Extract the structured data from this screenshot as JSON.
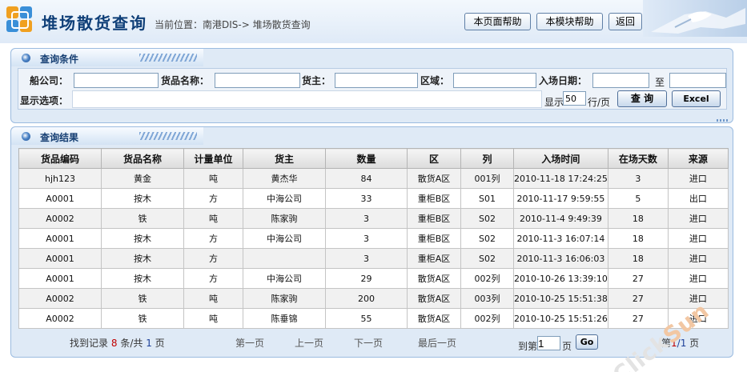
{
  "header": {
    "title": "堆场散货查询",
    "breadcrumb": "当前位置：南港DIS-> 堆场散货查询",
    "buttons": {
      "page_help": "本页面帮助",
      "module_help": "本模块帮助",
      "back": "返回"
    }
  },
  "search_panel": {
    "title": "查询条件",
    "fields": {
      "shipping_company": {
        "label": "船公司：",
        "value": ""
      },
      "goods_name": {
        "label": "货品名称：",
        "value": ""
      },
      "cargo_owner": {
        "label": "货主：",
        "value": ""
      },
      "area": {
        "label": "区域：",
        "value": ""
      },
      "entry_date": {
        "label": "入场日期：",
        "from": "",
        "to": "",
        "separator": "至"
      },
      "display_options": {
        "label": "显示选项："
      }
    },
    "page_size": {
      "prefix": "显示",
      "value": "50",
      "suffix": "行/页"
    },
    "query_button": "查 询",
    "excel_button": "Excel"
  },
  "results_panel": {
    "title": "查询结果",
    "columns": [
      "货品编码",
      "货品名称",
      "计量单位",
      "货主",
      "数量",
      "区",
      "列",
      "入场时间",
      "在场天数",
      "来源"
    ],
    "rows": [
      [
        "hjh123",
        "黄金",
        "吨",
        "黄杰华",
        "84",
        "散货A区",
        "001列",
        "2010-11-18 17:24:25",
        "3",
        "进口"
      ],
      [
        "A0001",
        "按木",
        "方",
        "中海公司",
        "33",
        "重柜B区",
        "S01",
        "2010-11-17 9:59:55",
        "5",
        "出口"
      ],
      [
        "A0002",
        "铁",
        "吨",
        "陈家驹",
        "3",
        "重柜B区",
        "S02",
        "2010-11-4 9:49:39",
        "18",
        "进口"
      ],
      [
        "A0001",
        "按木",
        "方",
        "中海公司",
        "3",
        "重柜B区",
        "S02",
        "2010-11-3 16:07:14",
        "18",
        "进口"
      ],
      [
        "A0001",
        "按木",
        "方",
        "",
        "3",
        "重柜A区",
        "S02",
        "2010-11-3 16:06:03",
        "18",
        "进口"
      ],
      [
        "A0001",
        "按木",
        "方",
        "中海公司",
        "29",
        "散货A区",
        "002列",
        "2010-10-26 13:39:10",
        "27",
        "进口"
      ],
      [
        "A0002",
        "铁",
        "吨",
        "陈家驹",
        "200",
        "散货A区",
        "003列",
        "2010-10-25 15:51:38",
        "27",
        "进口"
      ],
      [
        "A0002",
        "铁",
        "吨",
        "陈垂锦",
        "55",
        "散货A区",
        "002列",
        "2010-10-25 15:51:26",
        "27",
        "进口"
      ]
    ],
    "pager": {
      "found_prefix": "找到记录",
      "found_count": "8",
      "found_mid": "条/共",
      "total_pages": "1",
      "found_suffix": "页",
      "first": "第一页",
      "prev": "上一页",
      "next": "下一页",
      "last": "最后一页",
      "goto_prefix": "到第",
      "goto_value": "1",
      "goto_suffix": "页",
      "go_button": "Go",
      "current_prefix": "第",
      "current_page": "1",
      "current_sep": "/1",
      "current_suffix": "页"
    }
  },
  "watermark": {
    "text_a": "Click",
    "text_b": "Sun"
  },
  "colors": {
    "title": "#0f3f78",
    "panel_border": "#9bbbe0",
    "panel_bg": "#dfeaf6",
    "highlight": "#c00000"
  }
}
